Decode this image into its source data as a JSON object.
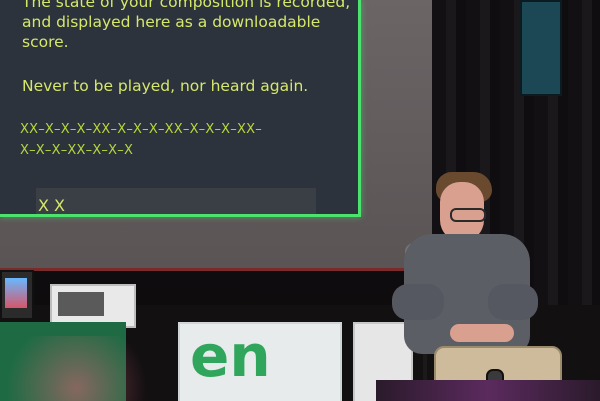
{
  "slide": {
    "line1": "The state of your composition is recorded,",
    "line2": "and displayed here as a downloadable",
    "line3": "score.",
    "line4": "Never to be played, nor heard again.",
    "score_line1": "XX–X–X–X–XX–X–X–X–XX–X–X–X–XX–",
    "score_line2": "X–X–X–XX–X–X–X",
    "inset_mark": "X X"
  },
  "props": {
    "box_white_text": "en"
  }
}
